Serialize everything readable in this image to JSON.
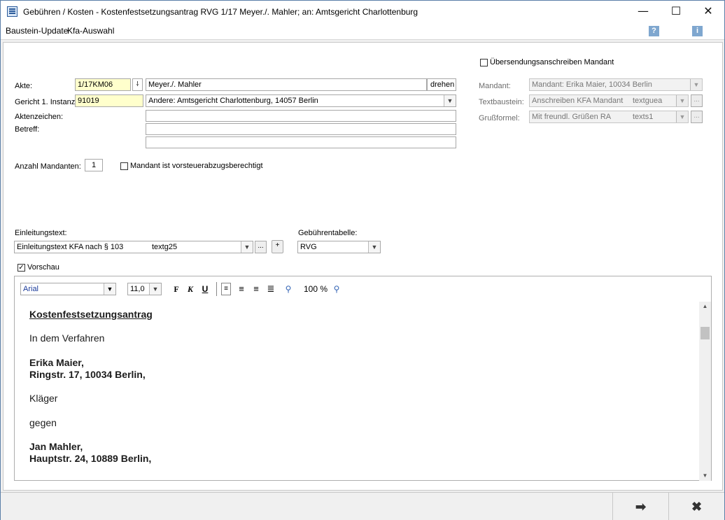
{
  "window": {
    "title": "Gebühren / Kosten - Kostenfestsetzungsantrag RVG 1/17 Meyer./. Mahler; an: Amtsgericht Charlottenburg",
    "minimize": "—",
    "maximize": "☐",
    "close": "✕"
  },
  "menu": {
    "item1": "Baustein-Update",
    "item2": "Kfa-Auswahl",
    "help_icon": "?",
    "info_icon": "i"
  },
  "form": {
    "akte_label": "Akte:",
    "akte_value": "1/17KM06",
    "akte_name": "Meyer./. Mahler",
    "drehen": "drehen",
    "gericht_label": "Gericht 1. Instanz",
    "gericht_value": "91019",
    "gericht_name": "Andere:   Amtsgericht Charlottenburg, 14057 Berlin",
    "aktenzeichen_label": "Aktenzeichen:",
    "betreff_label": "Betreff:",
    "anzahl_label": "Anzahl Mandanten:",
    "anzahl_value": "1",
    "vorsteuer_label": "Mandant ist vorsteuerabzugsberechtigt",
    "uebersendung_label": "Übersendungsanschreiben Mandant",
    "mandant_label": "Mandant:",
    "mandant_value": "Mandant: Erika Maier, 10034 Berlin",
    "textbaustein_label": "Textbaustein:",
    "textbaustein_value": "Anschreiben KFA Mandant",
    "textbaustein_code": "textguea",
    "grussformel_label": "Grußformel:",
    "grussformel_value": "Mit freundl. Grüßen RA",
    "grussformel_code": "texts1",
    "einleitung_label": "Einleitungstext:",
    "einleitung_value": "Einleitungstext KFA nach § 103",
    "einleitung_code": "textg25",
    "gebuehren_label": "Gebührentabelle:",
    "gebuehren_value": "RVG",
    "vorschau_label": "Vorschau",
    "ellipsis": "...",
    "plus": "+"
  },
  "editor": {
    "font": "Arial",
    "size": "11,0",
    "bold": "F",
    "italic": "K",
    "underline": "U",
    "zoom": "100 %",
    "lines": [
      "Kostenfestsetzungsantrag",
      "In dem Verfahren",
      "Erika Maier,",
      "Ringstr. 17, 10034 Berlin,",
      "Kläger",
      "gegen",
      "Jan Mahler,",
      "Hauptstr. 24, 10889 Berlin,"
    ]
  },
  "bottom": {
    "next": "➡",
    "cancel": "✖"
  }
}
